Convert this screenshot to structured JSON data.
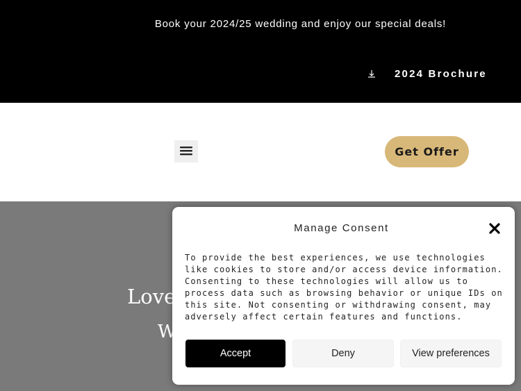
{
  "topbar": {
    "promo_text": "Book your 2024/25 wedding and enjoy our special deals!",
    "brochure_label": "2024 Brochure",
    "brochure_icon": "download-icon"
  },
  "header": {
    "menu_icon": "hamburger-menu-icon",
    "cta_label": "Get Offer",
    "cta_color": "#d8b878"
  },
  "hero": {
    "line1": "Love",
    "line2": "W"
  },
  "consent": {
    "title": "Manage Consent",
    "close_icon": "close-icon",
    "body": "To provide the best experiences, we use technologies like cookies to store and/or access device information. Consenting to these technologies will allow us to process data such as browsing behavior or unique IDs on this site. Not consenting or withdrawing consent, may adversely affect certain features and functions.",
    "accept_label": "Accept",
    "deny_label": "Deny",
    "preferences_label": "View preferences"
  }
}
